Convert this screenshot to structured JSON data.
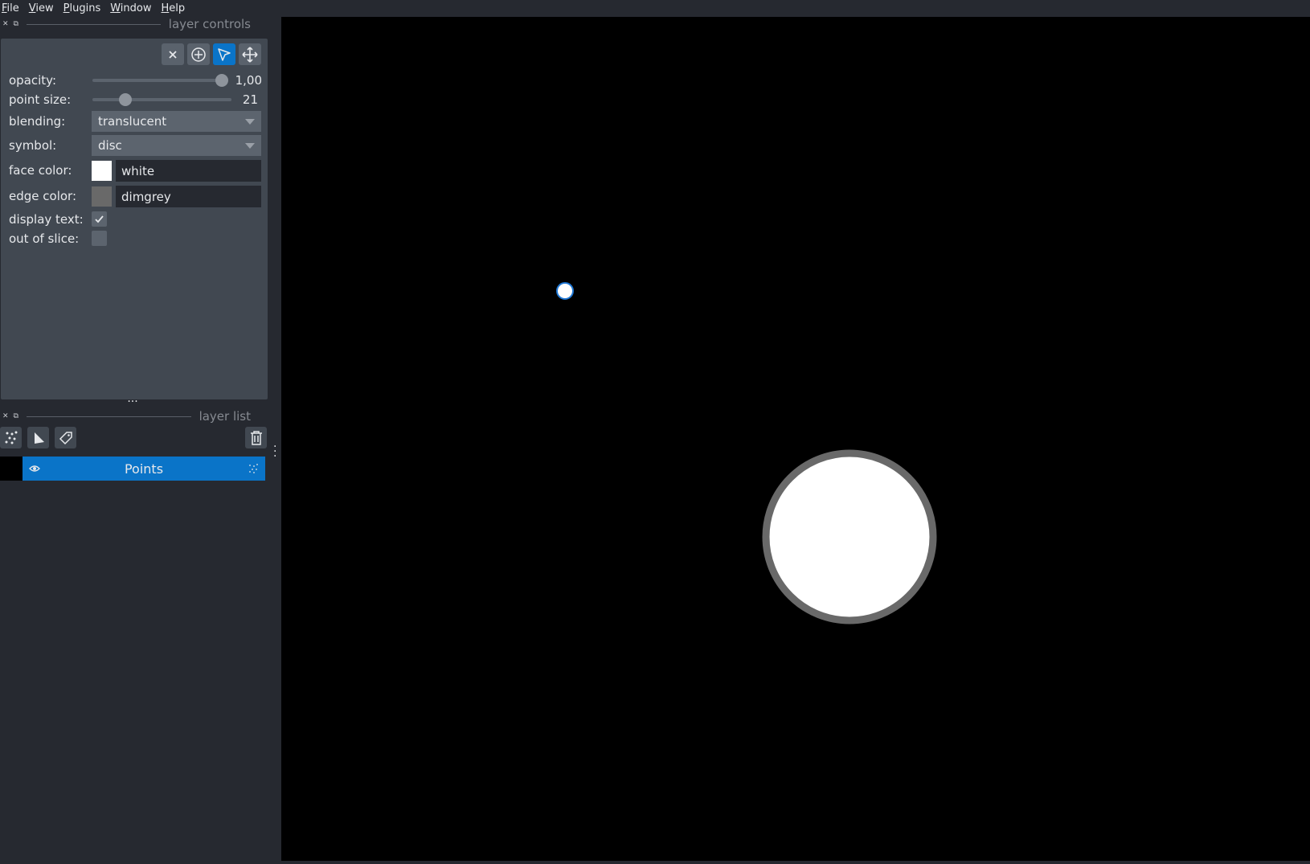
{
  "menu": [
    "File",
    "View",
    "Plugins",
    "Window",
    "Help"
  ],
  "layer_controls": {
    "title": "layer controls",
    "modes": [
      {
        "name": "delete-selected",
        "icon": "close-icon",
        "active": false
      },
      {
        "name": "add-points",
        "icon": "add-circle-icon",
        "active": false
      },
      {
        "name": "select-points",
        "icon": "select-arrow-icon",
        "active": true
      },
      {
        "name": "pan-zoom",
        "icon": "move-icon",
        "active": false
      }
    ],
    "opacity": {
      "label": "opacity:",
      "value_text": "1,00",
      "fraction": 1.0
    },
    "point_size": {
      "label": "point size:",
      "value_text": "21",
      "fraction": 0.2
    },
    "blending": {
      "label": "blending:",
      "value": "translucent"
    },
    "symbol": {
      "label": "symbol:",
      "value": "disc"
    },
    "face_color": {
      "label": "face color:",
      "value": "white",
      "swatch": "#ffffff"
    },
    "edge_color": {
      "label": "edge color:",
      "value": "dimgrey",
      "swatch": "#696969"
    },
    "display_text": {
      "label": "display text:",
      "checked": true
    },
    "out_of_slice": {
      "label": "out of slice:",
      "checked": false
    }
  },
  "layer_list": {
    "title": "layer list",
    "tools": [
      "new-points-layer",
      "new-shapes-layer",
      "new-labels-layer"
    ],
    "layers": [
      {
        "name": "Points",
        "visible": true,
        "selected": true
      }
    ]
  },
  "colors": {
    "accent": "#0a74c8",
    "panel": "#414851",
    "background": "#262930"
  }
}
